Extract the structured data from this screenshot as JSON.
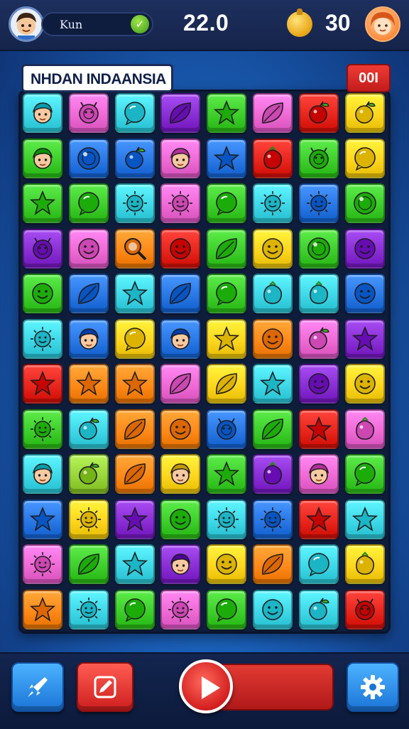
{
  "header": {
    "player_name": "Kun",
    "score": "22.0",
    "coins": "30",
    "avatar_left": "boy-avatar-icon",
    "avatar_right": "girl-avatar-icon",
    "coin_icon": "coin-icon",
    "badge_icon": "check-icon"
  },
  "board": {
    "level_title": "NHDAN INDAANSIA",
    "moves": "00I",
    "columns": 8,
    "rows": 12,
    "tiles": [
      [
        "cyan:face",
        "pink:bug",
        "cyan:bubble",
        "purple:leaf",
        "green:star",
        "pink:leaf",
        "red:fruit",
        "yellow:fruit"
      ],
      [
        "green:face",
        "blue:ball",
        "blue:fruit",
        "pink:face",
        "blue:star",
        "red:berry",
        "green:bug",
        "yellow:bubble"
      ],
      [
        "green:star",
        "green:bubble",
        "cyan:sun",
        "pink:sun",
        "green:bubble",
        "cyan:sun",
        "blue:sun",
        "green:ball"
      ],
      [
        "purple:bug",
        "pink:smile",
        "orange:magnifier",
        "red:smile",
        "green:leaf",
        "yellow:smile",
        "green:ball",
        "purple:smile"
      ],
      [
        "green:smile",
        "blue:leaf",
        "cyan:star",
        "blue:leaf",
        "green:bubble",
        "cyan:berry",
        "cyan:berry",
        "blue:smile"
      ],
      [
        "cyan:sun",
        "blue:face",
        "yellow:bubble",
        "blue:face",
        "yellow:star",
        "orange:smile",
        "pink:fruit",
        "purple:star"
      ],
      [
        "red:star",
        "orange:star",
        "orange:star",
        "pink:leaf",
        "yellow:leaf",
        "cyan:star",
        "purple:smile",
        "yellow:smile"
      ],
      [
        "green:sun",
        "cyan:fruit",
        "orange:leaf",
        "orange:smile",
        "blue:bug",
        "green:leaf",
        "red:star",
        "pink:berry"
      ],
      [
        "cyan:face",
        "lime:fruit",
        "orange:leaf",
        "yellow:face",
        "green:star",
        "purple:berry",
        "pink:face",
        "green:bubble"
      ],
      [
        "blue:star",
        "yellow:sun",
        "purple:star",
        "green:smile",
        "cyan:sun",
        "blue:sun",
        "red:star",
        "cyan:star"
      ],
      [
        "pink:sun",
        "green:leaf",
        "cyan:star",
        "purple:face",
        "yellow:smile",
        "orange:leaf",
        "cyan:bubble",
        "yellow:berry"
      ],
      [
        "orange:star",
        "cyan:sun",
        "green:bubble",
        "pink:sun",
        "green:bubble",
        "cyan:smile",
        "cyan:fruit",
        "red:bug"
      ]
    ]
  },
  "palette": {
    "cyan": "#3fd8e8",
    "pink": "#f06ad6",
    "purple": "#8a2fd6",
    "green": "#3fcf2c",
    "red": "#e8261e",
    "yellow": "#ffd61e",
    "blue": "#2a78e6",
    "orange": "#ff8a1a",
    "lime": "#98d63a"
  },
  "toolbar": {
    "rocket_icon": "rocket-icon",
    "pencil_icon": "pencil-icon",
    "play_icon": "play-icon",
    "settings_icon": "gear-icon"
  }
}
